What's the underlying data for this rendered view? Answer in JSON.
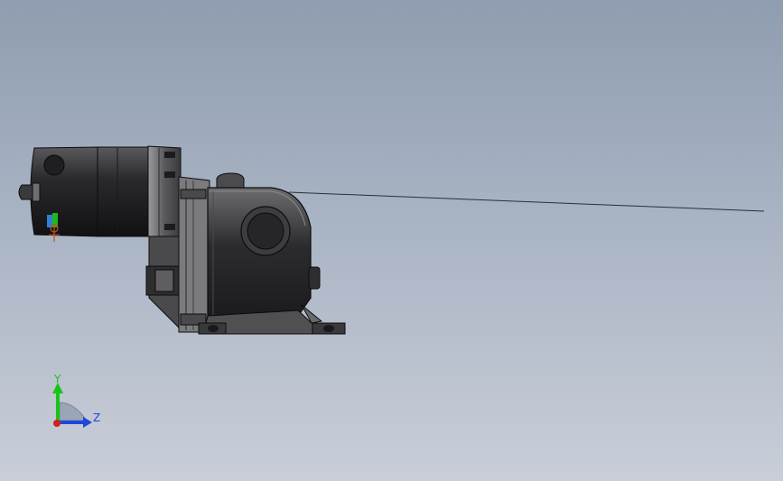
{
  "viewport": {
    "background_top": "#8f9db0",
    "background_bottom": "#c9ced8"
  },
  "model": {
    "description_icon": "gear-motor-assembly-icon",
    "body_color": "#2b2b2d",
    "edge_color": "#0c0c0c",
    "highlight_color": "#8a8a8a"
  },
  "triad": {
    "y_label": "Y",
    "z_label": "Z",
    "y_color": "#18c418",
    "z_color": "#1e46d8",
    "x_color": "#d41e1e"
  }
}
